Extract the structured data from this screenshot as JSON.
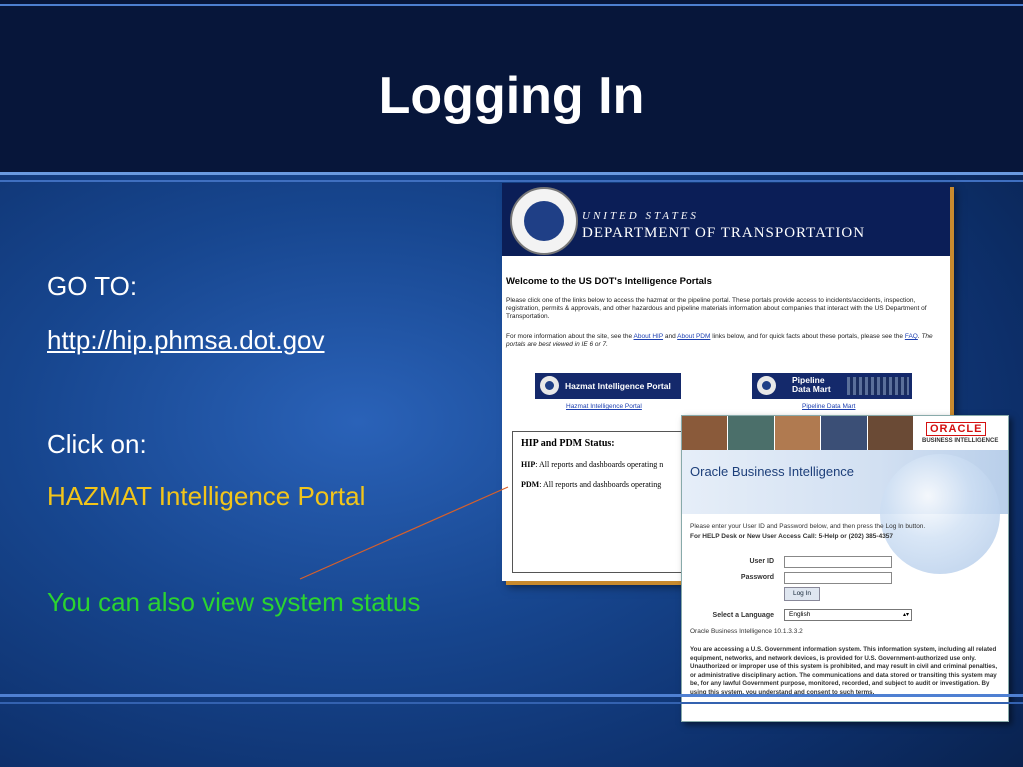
{
  "slide": {
    "title": "Logging In",
    "go_to_label": "GO TO:",
    "url": "http://hip.phmsa.dot.gov",
    "click_on_label": "Click on:",
    "portal_name": "HAZMAT Intelligence Portal",
    "status_note": "You can also view system status"
  },
  "colors": {
    "yellow": "#f2c51a",
    "green": "#2bd430",
    "arrow": "#d8602a"
  },
  "dot_site": {
    "united_states": "UNITED STATES",
    "department": "DEPARTMENT OF TRANSPORTATION",
    "welcome": "Welcome to the US DOT's Intelligence Portals",
    "para1": "Please click one of the links below to access the hazmat or the pipeline portal. These portals provide access to incidents/accidents, inspection, registration, permits & approvals, and other hazardous and pipeline materials information about companies that interact with the US Department of Transportation.",
    "para2_pre": "For more information about the site, see the ",
    "about_hip": "About HIP",
    "and": " and ",
    "about_pdm": "About PDM",
    "para2_post": " links below, and for quick facts about these portals, please see the ",
    "faq": "FAQ",
    "para2_end": ". The portals are best viewed in IE 6 or 7.",
    "hazmat_button": "Hazmat Intelligence Portal",
    "hazmat_link": "Hazmat Intelligence Portal",
    "pipeline_button_line1": "Pipeline",
    "pipeline_button_line2": "Data Mart",
    "pipeline_link": "Pipeline Data Mart",
    "status_heading": "HIP and PDM Status:",
    "hip_label": "HIP",
    "hip_text": ": All reports and dashboards operating n",
    "pdm_label": "PDM",
    "pdm_text": ": All reports and dashboards operating"
  },
  "oracle_site": {
    "oracle_logo": "ORACLE",
    "logo_sub": "BUSINESS INTELLIGENCE",
    "banner_title": "Oracle Business Intelligence",
    "instructions": "Please enter your User ID and Password below, and then press the Log In button.",
    "help_desk": "For HELP Desk or New User Access Call: 5-Help or (202) 385-4357",
    "user_id_label": "User ID",
    "password_label": "Password",
    "login_button": "Log In",
    "language_label": "Select a Language",
    "language_value": "English",
    "version": "Oracle Business Intelligence 10.1.3.3.2",
    "notice": "You are accessing a U.S. Government information system. This information system, including all related equipment, networks, and network devices, is provided for U.S. Government-authorized use only. Unauthorized or improper use of this system is prohibited, and may result in civil and criminal penalties, or administrative disciplinary action. The communications and data stored or transiting this system may be, for any lawful Government purpose, monitored, recorded, and subject to audit or investigation. By using this system, you understand and consent to such terms."
  }
}
